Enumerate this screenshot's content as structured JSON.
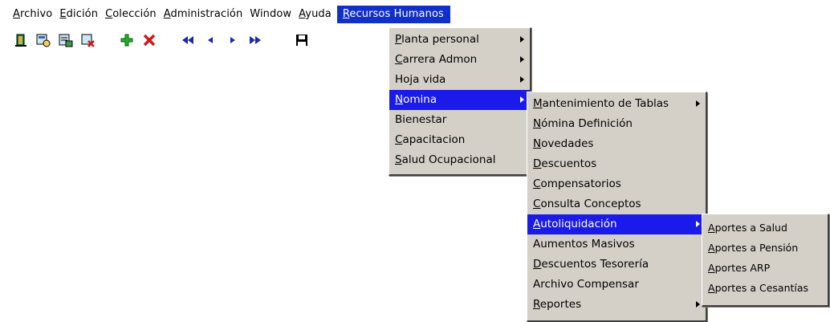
{
  "menubar": [
    {
      "label": "Archivo"
    },
    {
      "label": "Edición"
    },
    {
      "label": "Colección"
    },
    {
      "label": "Administración"
    },
    {
      "label": "Window"
    },
    {
      "label": "Ayuda"
    },
    {
      "label": "Recursos Humanos"
    }
  ],
  "toolbar_icons": [
    "exit-door-icon",
    "form-query-icon",
    "form-list-icon",
    "form-delete-icon",
    "add-record-icon",
    "delete-record-icon",
    "first-record-icon",
    "previous-record-icon",
    "next-record-icon",
    "last-record-icon",
    "save-icon"
  ],
  "menu_rrhh": [
    {
      "label": "Planta personal",
      "submenu": true
    },
    {
      "label": "Carrera Admon",
      "submenu": true
    },
    {
      "label": "Hoja vida",
      "submenu": true
    },
    {
      "label": "Nomina",
      "submenu": true,
      "selected": true
    },
    {
      "label": "Bienestar"
    },
    {
      "label": "Capacitacion"
    },
    {
      "label": "Salud Ocupacional"
    }
  ],
  "menu_nomina": [
    {
      "label": "Mantenimiento de Tablas",
      "submenu": true
    },
    {
      "label": "Nómina Definición"
    },
    {
      "label": "Novedades"
    },
    {
      "label": "Descuentos"
    },
    {
      "label": "Compensatorios"
    },
    {
      "label": "Consulta Conceptos"
    },
    {
      "label": "Autoliquidación",
      "submenu": true,
      "selected": true
    },
    {
      "label": "Aumentos Masivos"
    },
    {
      "label": "Descuentos Tesorería"
    },
    {
      "label": "Archivo Compensar"
    },
    {
      "label": "Reportes",
      "submenu": true
    }
  ],
  "menu_autoliquidacion": [
    {
      "label": "Aportes a Salud"
    },
    {
      "label": "Aportes a Pensión"
    },
    {
      "label": "Aportes ARP"
    },
    {
      "label": "Aportes a Cesantías"
    }
  ],
  "colors": {
    "selection": "#1a1aea",
    "menu_bg": "#d4d0c8",
    "menubar_active": "#1030c8"
  }
}
